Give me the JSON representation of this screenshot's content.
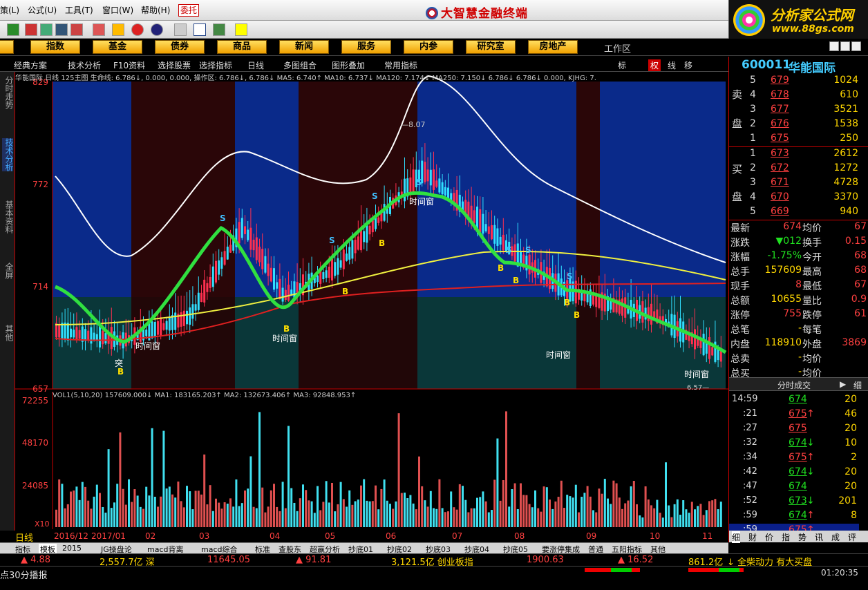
{
  "menu": [
    "策(L)",
    "公式(U)",
    "工具(T)",
    "窗口(W)",
    "帮助(H)"
  ],
  "menu_wt": "委托",
  "app_title": "大智慧金融终端",
  "brand": {
    "line1": "分析家公式网",
    "line2": "www.88gs.com"
  },
  "nav": [
    "指数",
    "基金",
    "债券",
    "商品",
    "新闻",
    "服务",
    "内参",
    "研究室",
    "房地产"
  ],
  "nav_left": "股",
  "workarea": "工作区",
  "subbar": [
    "经典方案",
    "技术分析",
    "F10资料",
    "选择股票",
    "选择指标",
    "日线",
    "多图组合",
    "图形叠加",
    "常用指标"
  ],
  "subbar_right": [
    "标",
    "权",
    "线",
    "移"
  ],
  "left_tabs": [
    "分时走势",
    "技术分析",
    "基本资料",
    "全屏",
    "其他"
  ],
  "chart_header": "华能国际 日线 125主图 生命线: 6.786↓, 0.000, 0.000, 操作区: 6.786↓, 6.786↓ MA5: 6.740↑ MA10: 6.737↓ MA120: 7.174↓ MA250: 7.150↓ 6.786↓ 6.786↓ 0.000, KJHG: 7.",
  "vol_header": "VOL1(5,10,20) 157609.000↓ MA1: 183165.203↑ MA2: 132673.406↑ MA3: 92848.953↑",
  "price_axis": [
    "829",
    "772",
    "714",
    "657"
  ],
  "vol_axis": [
    "72255",
    "48170",
    "24085"
  ],
  "vol_unit": "X10",
  "labels": {
    "high": "8.07",
    "low": "6.57",
    "window": "时间窗",
    "buy": "B",
    "sell": "S",
    "tu": "突"
  },
  "period_label": "日线",
  "date_axis": [
    "2016/12",
    "2017/01",
    "02",
    "03",
    "04",
    "05",
    "06",
    "07",
    "08",
    "09",
    "10",
    "11"
  ],
  "bottom_tabs": [
    "指标",
    "模板",
    "2015",
    "JG操盘论",
    "macd背离",
    "macd综合",
    "标准",
    "查股东",
    "超赢分析",
    "抄底01",
    "抄底02",
    "抄底03",
    "抄底04",
    "抄底05",
    "要涨停集成",
    "普通",
    "五阳指标",
    "其他"
  ],
  "status1": [
    {
      "t": "▲ 4.88",
      "c": "red"
    },
    {
      "t": "2,557.7亿 深",
      "c": "yel"
    },
    {
      "t": "11645.05",
      "c": "red"
    },
    {
      "t": "▲ 91.81",
      "c": "red"
    },
    {
      "t": "3,121.5亿 创业板指",
      "c": "yel"
    },
    {
      "t": "1900.63",
      "c": "red"
    },
    {
      "t": "▲ 16.52",
      "c": "red"
    },
    {
      "t": "861.2亿",
      "c": "yel"
    },
    {
      "t": "↓ 全柴动力 有大买盘",
      "c": "yel"
    }
  ],
  "status2_left": "点30分播报",
  "clock": "01:20:35",
  "stock": {
    "code": "600011",
    "name": "华能国际"
  },
  "sell_label": [
    "卖",
    "盘"
  ],
  "buy_label": [
    "买",
    "盘"
  ],
  "asks": [
    {
      "n": "5",
      "p": "679",
      "v": "1024"
    },
    {
      "n": "4",
      "p": "678",
      "v": "610"
    },
    {
      "n": "3",
      "p": "677",
      "v": "3521"
    },
    {
      "n": "2",
      "p": "676",
      "v": "1538"
    },
    {
      "n": "1",
      "p": "675",
      "v": "250"
    }
  ],
  "bids": [
    {
      "n": "1",
      "p": "673",
      "v": "2612"
    },
    {
      "n": "2",
      "p": "672",
      "v": "1272"
    },
    {
      "n": "3",
      "p": "671",
      "v": "4728"
    },
    {
      "n": "4",
      "p": "670",
      "v": "3370"
    },
    {
      "n": "5",
      "p": "669",
      "v": "940"
    }
  ],
  "quote": [
    {
      "l": "最新",
      "v": "674",
      "l2": "均价",
      "v2": "67"
    },
    {
      "l": "涨跌",
      "v": "▼012",
      "l2": "换手",
      "v2": "0.15"
    },
    {
      "l": "涨幅",
      "v": "-1.75%",
      "l2": "今开",
      "v2": "68"
    },
    {
      "l": "总手",
      "v": "157609",
      "l2": "最高",
      "v2": "68"
    },
    {
      "l": "现手",
      "v": "8",
      "l2": "最低",
      "v2": "67"
    },
    {
      "l": "总额",
      "v": "10655",
      "l2": "量比",
      "v2": "0.9"
    },
    {
      "l": "涨停",
      "v": "755",
      "l2": "跌停",
      "v2": "61"
    },
    {
      "l": "总笔",
      "v": "-",
      "l2": "每笔",
      "v2": ""
    },
    {
      "l": "内盘",
      "v": "118910",
      "l2": "外盘",
      "v2": "3869"
    },
    {
      "l": "总卖",
      "v": "-",
      "l2": "均价",
      "v2": ""
    },
    {
      "l": "总买",
      "v": "-",
      "l2": "均价",
      "v2": ""
    }
  ],
  "ticks_title": "分时成交",
  "ticks_tab": "细",
  "ticks": [
    {
      "t": "14:59",
      "p": "674",
      "a": "",
      "v": "20"
    },
    {
      "t": ":21",
      "p": "675",
      "a": "↑",
      "v": "46"
    },
    {
      "t": ":27",
      "p": "675",
      "a": "",
      "v": "20"
    },
    {
      "t": ":32",
      "p": "674",
      "a": "↓",
      "v": "10"
    },
    {
      "t": ":34",
      "p": "675",
      "a": "↑",
      "v": "2"
    },
    {
      "t": ":42",
      "p": "674",
      "a": "↓",
      "v": "20"
    },
    {
      "t": ":47",
      "p": "674",
      "a": "",
      "v": "20"
    },
    {
      "t": ":52",
      "p": "673",
      "a": "↓",
      "v": "201"
    },
    {
      "t": ":59",
      "p": "674",
      "a": "↑",
      "v": "8"
    },
    {
      "t": ":59",
      "p": "675",
      "a": "↑",
      "v": ""
    }
  ],
  "rp_bottom_tabs": [
    "细",
    "财",
    "价",
    "指",
    "势",
    "讯",
    "成",
    "评"
  ]
}
